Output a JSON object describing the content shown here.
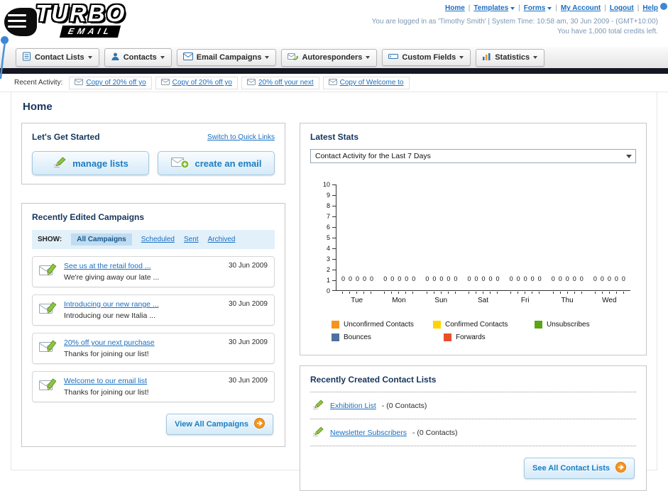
{
  "header": {
    "logo_line1": "TURBO",
    "logo_line2": "EMAIL",
    "sep": "|",
    "nav": [
      {
        "label": "Home"
      },
      {
        "label": "Templates"
      },
      {
        "label": "Forms"
      },
      {
        "label": "My Account"
      },
      {
        "label": "Logout"
      },
      {
        "label": "Help"
      }
    ],
    "login_info": "You are logged in as 'Timothy Smith' | System Time: 10:58 am, 30 Jun 2009 - (GMT+10:00)",
    "credits": "You have 1,000 total credits left."
  },
  "tabs": [
    {
      "label": "Contact Lists"
    },
    {
      "label": "Contacts"
    },
    {
      "label": "Email Campaigns"
    },
    {
      "label": "Autoresponders"
    },
    {
      "label": "Custom Fields"
    },
    {
      "label": "Statistics"
    }
  ],
  "recent_activity": {
    "label": "Recent Activity:",
    "items": [
      "Copy of 20% off yo",
      "Copy of 20% off yo",
      "20% off your next",
      "Copy of Welcome to"
    ]
  },
  "page_title": "Home",
  "get_started": {
    "title": "Let's Get Started",
    "switch_link": "Switch to Quick Links",
    "manage_lists_label": "manage lists",
    "create_email_label": "create an email"
  },
  "campaigns": {
    "title": "Recently Edited Campaigns",
    "show_label": "SHOW:",
    "filters": [
      "All Campaigns",
      "Scheduled",
      "Sent",
      "Archived"
    ],
    "items": [
      {
        "title": "See us at the retail food ...",
        "subtitle": "We're giving away our late ...",
        "date": "30 Jun 2009"
      },
      {
        "title": "Introducing our new range ...",
        "subtitle": "Introducing our new Italia ...",
        "date": "30 Jun 2009"
      },
      {
        "title": "20% off your next purchase",
        "subtitle": "Thanks for joining our list!",
        "date": "30 Jun 2009"
      },
      {
        "title": "Welcome to our email list",
        "subtitle": "Thanks for joining our list!",
        "date": "30 Jun 2009"
      }
    ],
    "view_all_label": "View All Campaigns"
  },
  "stats": {
    "title": "Latest Stats",
    "dropdown_value": "Contact Activity for the Last 7 Days",
    "chart_data": {
      "type": "bar",
      "title": "Contact Activity for the Last 7 Days",
      "categories": [
        "Tue",
        "Mon",
        "Sun",
        "Sat",
        "Fri",
        "Thu",
        "Wed"
      ],
      "series": [
        {
          "name": "Unconfirmed Contacts",
          "color": "#f7941d",
          "values": [
            0,
            0,
            0,
            0,
            0,
            0,
            0
          ]
        },
        {
          "name": "Confirmed Contacts",
          "color": "#ffd400",
          "values": [
            0,
            0,
            0,
            0,
            0,
            0,
            0
          ]
        },
        {
          "name": "Unsubscribes",
          "color": "#5aa515",
          "values": [
            0,
            0,
            0,
            0,
            0,
            0,
            0
          ]
        },
        {
          "name": "Bounces",
          "color": "#4f6fa0",
          "values": [
            0,
            0,
            0,
            0,
            0,
            0,
            0
          ]
        },
        {
          "name": "Forwards",
          "color": "#e8502a",
          "values": [
            0,
            0,
            0,
            0,
            0,
            0,
            0
          ]
        }
      ],
      "xlabel": "",
      "ylabel": "",
      "ylim": [
        0,
        10
      ],
      "ytick_step": 1,
      "grid": false,
      "legend_position": "bottom"
    }
  },
  "contact_lists": {
    "title": "Recently Created Contact Lists",
    "items": [
      {
        "name": "Exhibition List",
        "suffix": "- (0 Contacts)"
      },
      {
        "name": "Newsletter Subscribers",
        "suffix": "- (0 Contacts)"
      }
    ],
    "see_all_label": "See All Contact Lists"
  }
}
